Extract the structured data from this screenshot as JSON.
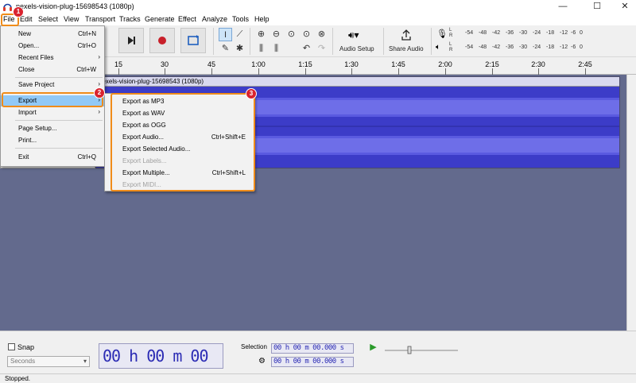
{
  "window": {
    "title": "pexels-vision-plug-15698543 (1080p)",
    "icon": "audacity-headphones-icon",
    "minimize": "—",
    "maximize": "☐",
    "close": "✕"
  },
  "menubar": [
    "File",
    "Edit",
    "Select",
    "View",
    "Transport",
    "Tracks",
    "Generate",
    "Effect",
    "Analyze",
    "Tools",
    "Help"
  ],
  "toolbar": {
    "audio_setup_label": "Audio Setup",
    "share_audio_label": "Share Audio",
    "meter_ticks": [
      "-54",
      "-48",
      "-42",
      "-36",
      "-30",
      "-24",
      "-18",
      "-12",
      "-6",
      "0"
    ],
    "meter_channels": [
      "L",
      "R"
    ]
  },
  "ruler": {
    "ticks": [
      "15",
      "30",
      "45",
      "1:00",
      "1:15",
      "1:30",
      "1:45",
      "2:00",
      "2:15",
      "2:30",
      "2:45"
    ]
  },
  "track": {
    "name": "pexels-vision-plug-15698543 (1080p)",
    "waveform_color": "#3c3cc8"
  },
  "file_menu": {
    "items": [
      {
        "label": "New",
        "shortcut": "Ctrl+N"
      },
      {
        "label": "Open...",
        "shortcut": "Ctrl+O"
      },
      {
        "label": "Recent Files",
        "submenu": true
      },
      {
        "label": "Close",
        "shortcut": "Ctrl+W"
      },
      {
        "label": "Save Project",
        "submenu": true
      },
      {
        "label": "Export",
        "submenu": true,
        "highlighted": true
      },
      {
        "label": "Import",
        "submenu": true
      },
      {
        "label": "Page Setup..."
      },
      {
        "label": "Print..."
      },
      {
        "label": "Exit",
        "shortcut": "Ctrl+Q"
      }
    ]
  },
  "export_menu": {
    "items": [
      {
        "label": "Export as MP3"
      },
      {
        "label": "Export as WAV"
      },
      {
        "label": "Export as OGG"
      },
      {
        "label": "Export Audio...",
        "shortcut": "Ctrl+Shift+E"
      },
      {
        "label": "Export Selected Audio..."
      },
      {
        "label": "Export Labels...",
        "disabled": true
      },
      {
        "label": "Export Multiple...",
        "shortcut": "Ctrl+Shift+L"
      },
      {
        "label": "Export MIDI...",
        "disabled": true
      }
    ]
  },
  "badges": [
    "1",
    "2",
    "3"
  ],
  "highlight_color": "#f08c1a",
  "badge_color": "#d9232f",
  "bottom": {
    "snap_label": "Snap",
    "snap_unit": "Seconds",
    "time": "00 h 00 m 00 s",
    "selection_label": "Selection",
    "selection_start": "00 h 00 m 00.000 s",
    "selection_end": "00 h 00 m 00.000 s"
  },
  "status": "Stopped."
}
